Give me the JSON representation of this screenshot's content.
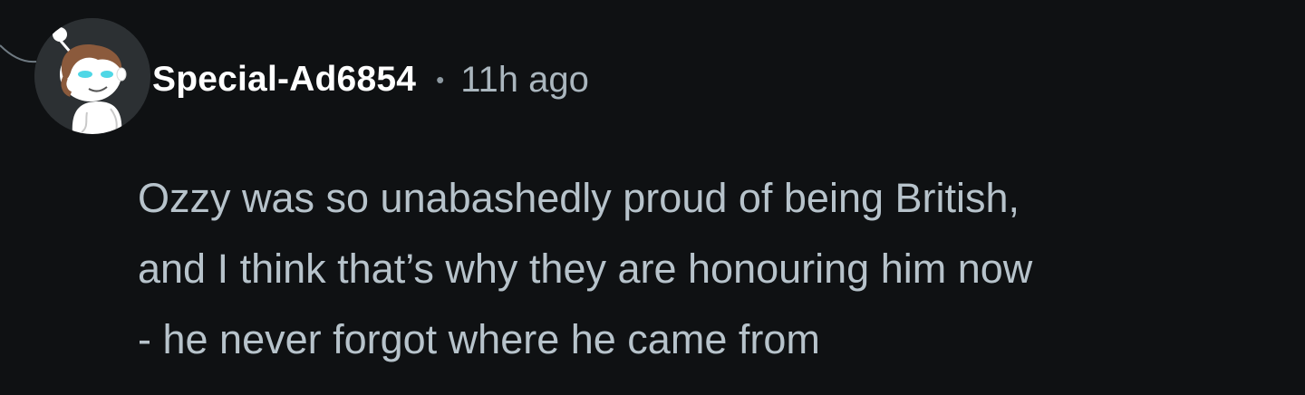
{
  "comment": {
    "author": {
      "username": "Special-Ad6854",
      "avatar_icon": "snoo-avatar-icon"
    },
    "separator": "•",
    "timestamp": "11h ago",
    "body": "Ozzy was so unabashedly proud of being British,\nand I think that’s why they are honouring him now\n- he never forgot where he came from"
  },
  "colors": {
    "background": "#0f1113",
    "username": "#ffffff",
    "meta": "#aab6be",
    "body_text": "#b7c3cb",
    "avatar_bg": "#2c3033",
    "avatar_hair": "#8b5a3c",
    "avatar_eyes": "#4fd7e6"
  }
}
